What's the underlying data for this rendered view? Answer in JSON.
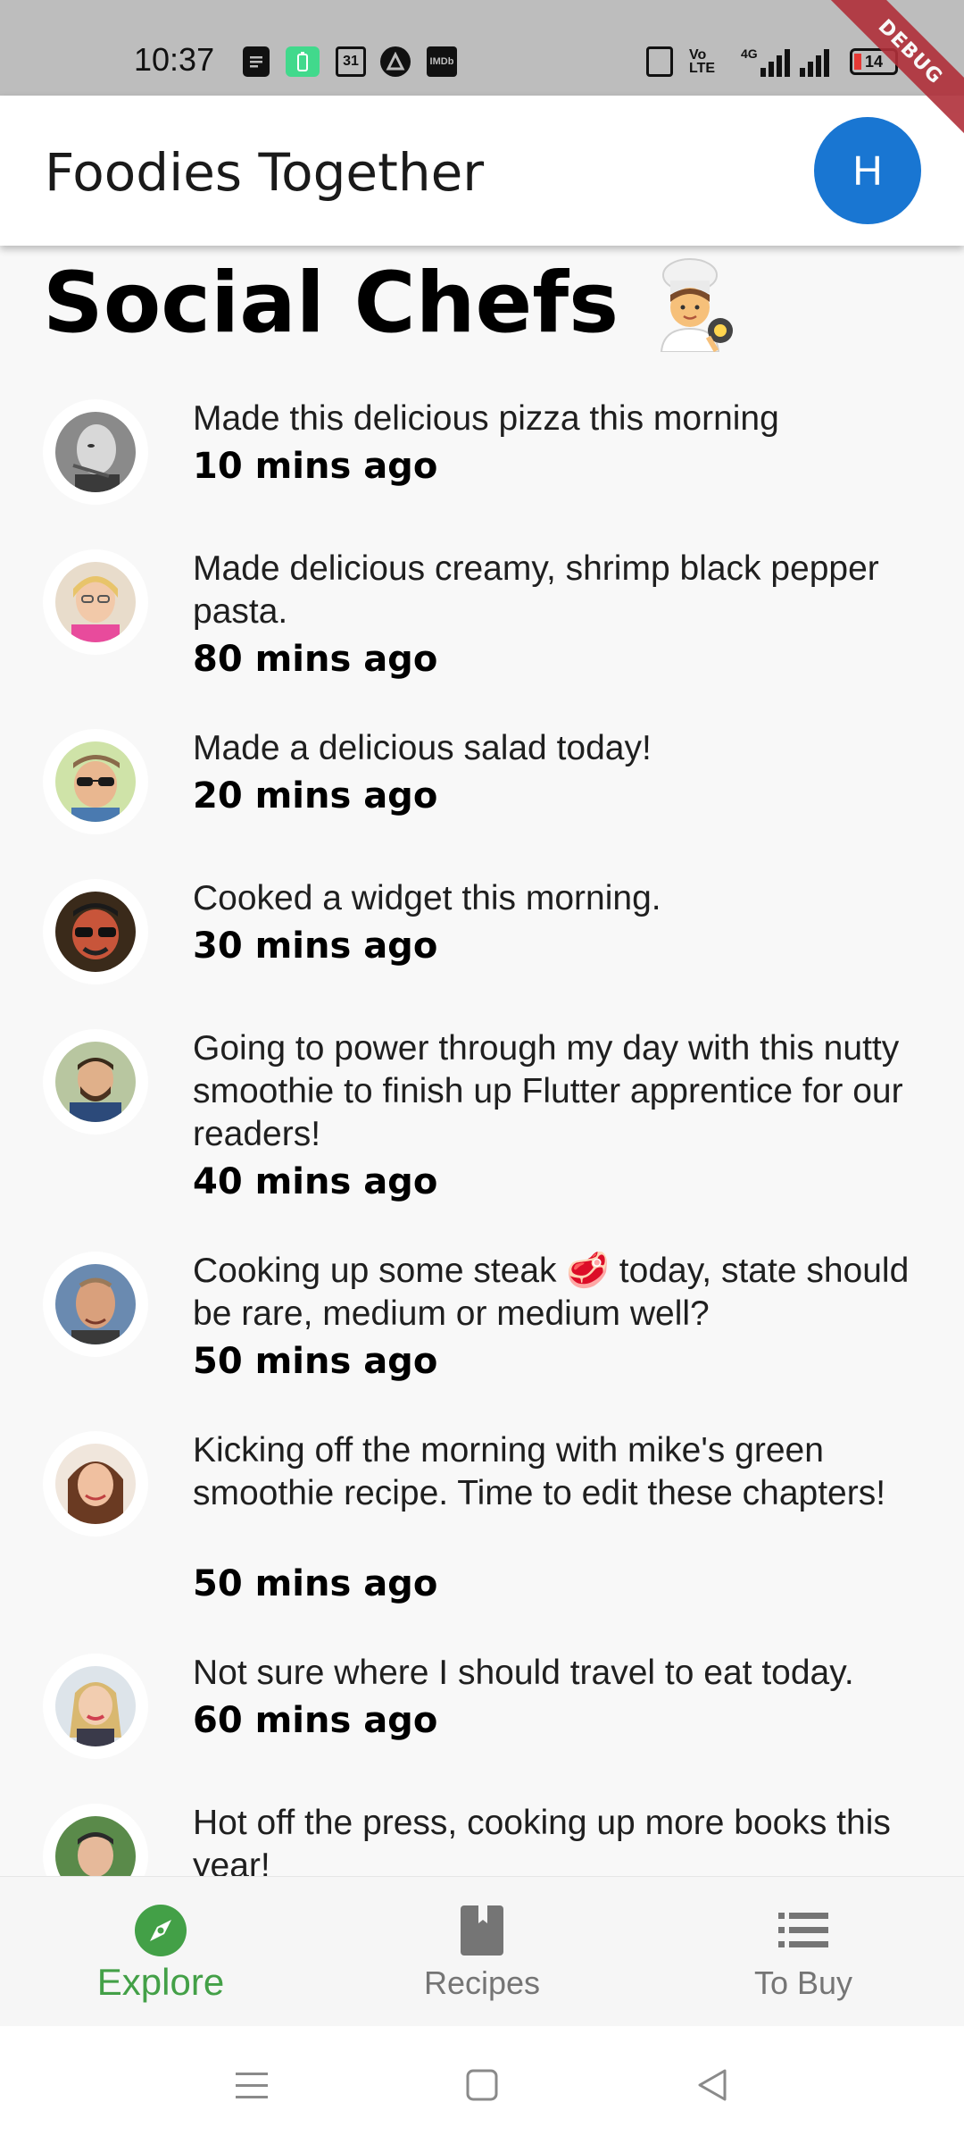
{
  "status_bar": {
    "time": "10:37",
    "left_icons": [
      "notes-icon",
      "battery-saver-icon",
      "calendar-icon",
      "app-icon",
      "imdb-icon"
    ],
    "calendar_day": "31",
    "imdb_label": "IMDb",
    "volte_label": "Vo LTE",
    "network_label": "4G",
    "battery_level": "14",
    "debug_label": "DEBUG"
  },
  "app_bar": {
    "title": "Foodies Together",
    "avatar_initial": "H",
    "avatar_color": "#1976d2"
  },
  "feed": {
    "heading": "Social Chefs",
    "heading_emoji": "👩‍🍳",
    "posts": [
      {
        "text": "Made this delicious pizza this morning",
        "time": "10 mins ago"
      },
      {
        "text": "Made delicious creamy, shrimp black pepper pasta.",
        "time": "80 mins ago"
      },
      {
        "text": "Made a delicious salad today!",
        "time": "20 mins ago"
      },
      {
        "text": "Cooked a widget this morning.",
        "time": "30 mins ago"
      },
      {
        "text": "Going to power through my day with this nutty smoothie to finish up Flutter apprentice for our readers!",
        "time": "40 mins ago"
      },
      {
        "text": "Cooking up some steak 🥩 today, state should be rare, medium or medium well?",
        "time": "50 mins ago"
      },
      {
        "text": "Kicking off the morning with mike's green smoothie recipe. Time to edit these chapters!",
        "time": "50 mins ago"
      },
      {
        "text": "Not sure where I should travel to eat today.",
        "time": "60 mins ago"
      },
      {
        "text": "Hot off the press, cooking up more books this year!",
        "time": ""
      }
    ]
  },
  "bottom_nav": {
    "items": [
      {
        "label": "Explore",
        "icon": "explore-icon",
        "active": true
      },
      {
        "label": "Recipes",
        "icon": "book-icon",
        "active": false
      },
      {
        "label": "To Buy",
        "icon": "list-icon",
        "active": false
      }
    ],
    "active_color": "#43a047",
    "inactive_color": "#757575"
  },
  "system_nav": {
    "buttons": [
      "menu-icon",
      "home-icon",
      "back-icon"
    ]
  }
}
